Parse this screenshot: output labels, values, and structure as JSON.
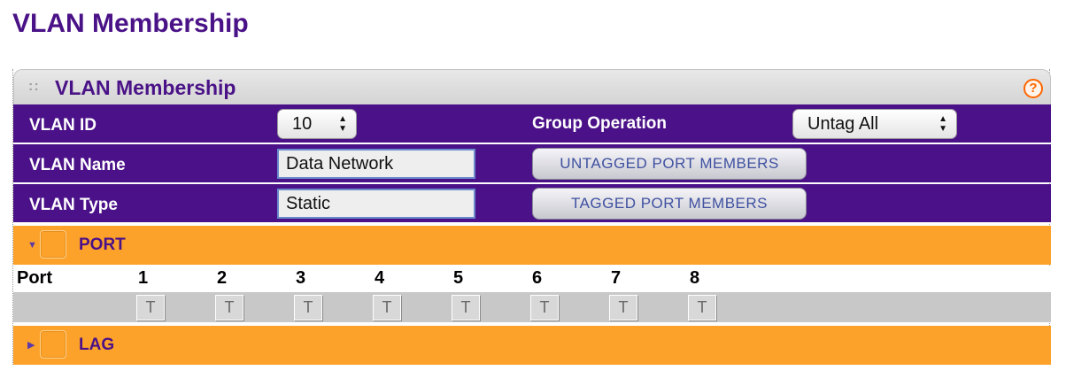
{
  "page": {
    "title": "VLAN Membership"
  },
  "panel": {
    "title": "VLAN Membership",
    "grip": "::",
    "help_icon": "?"
  },
  "form": {
    "vlan_id": {
      "label": "VLAN ID",
      "value": "10"
    },
    "group_operation": {
      "label": "Group Operation",
      "value": "Untag All"
    },
    "vlan_name": {
      "label": "VLAN Name",
      "value": "Data Network"
    },
    "vlan_type": {
      "label": "VLAN Type",
      "value": "Static"
    },
    "untagged_button": "UNTAGGED PORT MEMBERS",
    "tagged_button": "TAGGED PORT MEMBERS"
  },
  "port_section": {
    "label": "PORT",
    "expanded": true,
    "header": "Port",
    "ports": [
      {
        "num": "1",
        "tag": "T"
      },
      {
        "num": "2",
        "tag": "T"
      },
      {
        "num": "3",
        "tag": "T"
      },
      {
        "num": "4",
        "tag": "T"
      },
      {
        "num": "5",
        "tag": "T"
      },
      {
        "num": "6",
        "tag": "T"
      },
      {
        "num": "7",
        "tag": "T"
      },
      {
        "num": "8",
        "tag": "T"
      }
    ]
  },
  "lag_section": {
    "label": "LAG",
    "expanded": false
  },
  "colors": {
    "title_purple": "#4a1287",
    "row_purple": "#4b1188",
    "section_orange": "#fca22b",
    "button_text": "#3f51a0",
    "help_orange": "#ff6600"
  }
}
